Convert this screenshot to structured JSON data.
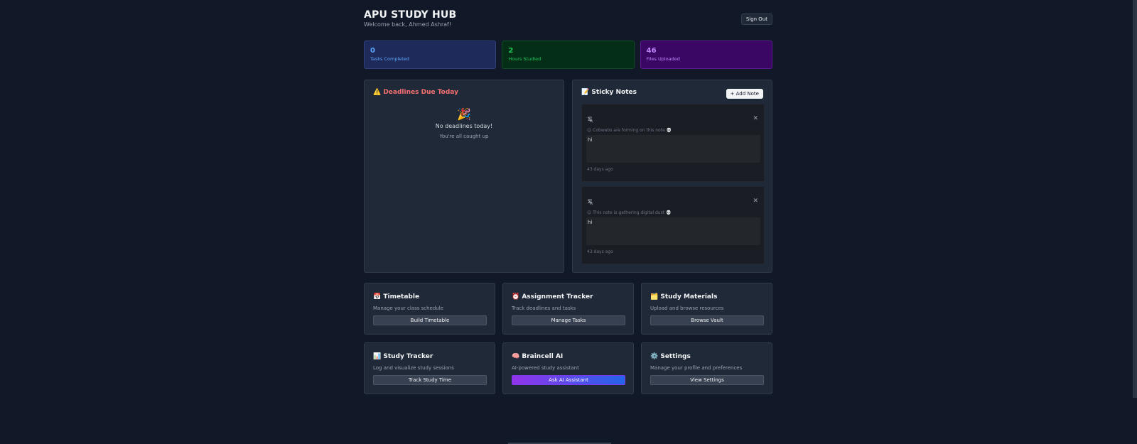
{
  "header": {
    "title": "APU STUDY HUB",
    "welcome": "Welcome back, Ahmed Ashraf!",
    "sign_out": "Sign Out"
  },
  "stats": [
    {
      "value": "0",
      "label": "Tasks Completed",
      "color": "#60a5fa"
    },
    {
      "value": "2",
      "label": "Hours Studied",
      "color": "#22c55e"
    },
    {
      "value": "46",
      "label": "Files Uploaded",
      "color": "#c084fc"
    }
  ],
  "deadlines": {
    "title": "⚠️ Deadlines Due Today",
    "empty_emoji": "🎉",
    "empty_title": "No deadlines today!",
    "empty_subtitle": "You're all caught up"
  },
  "sticky_notes": {
    "title": "📝 Sticky Notes",
    "add_label": "+ Add Note",
    "notes": [
      {
        "pin_icon": "unpin-icon",
        "subtitle": "☺ Cobwebs are forming on this note 💀",
        "body": "hi",
        "age": "43 days ago"
      },
      {
        "pin_icon": "unpin-icon",
        "subtitle": "☺ This note is gathering digital dust 💀",
        "body": "hi",
        "age": "43 days ago"
      }
    ]
  },
  "features": [
    {
      "title": "📅 Timetable",
      "desc": "Manage your class schedule",
      "button": "Build Timetable"
    },
    {
      "title": "⏰ Assignment Tracker",
      "desc": "Track deadlines and tasks",
      "button": "Manage Tasks"
    },
    {
      "title": "🗂️ Study Materials",
      "desc": "Upload and browse resources",
      "button": "Browse Vault"
    },
    {
      "title": "📊 Study Tracker",
      "desc": "Log and visualize study sessions",
      "button": "Track Study Time"
    },
    {
      "title": "🧠 Braincell AI",
      "desc": "AI-powered study assistant",
      "button": "Ask AI Assistant"
    },
    {
      "title": "⚙️ Settings",
      "desc": "Manage your profile and preferences",
      "button": "View Settings"
    }
  ]
}
